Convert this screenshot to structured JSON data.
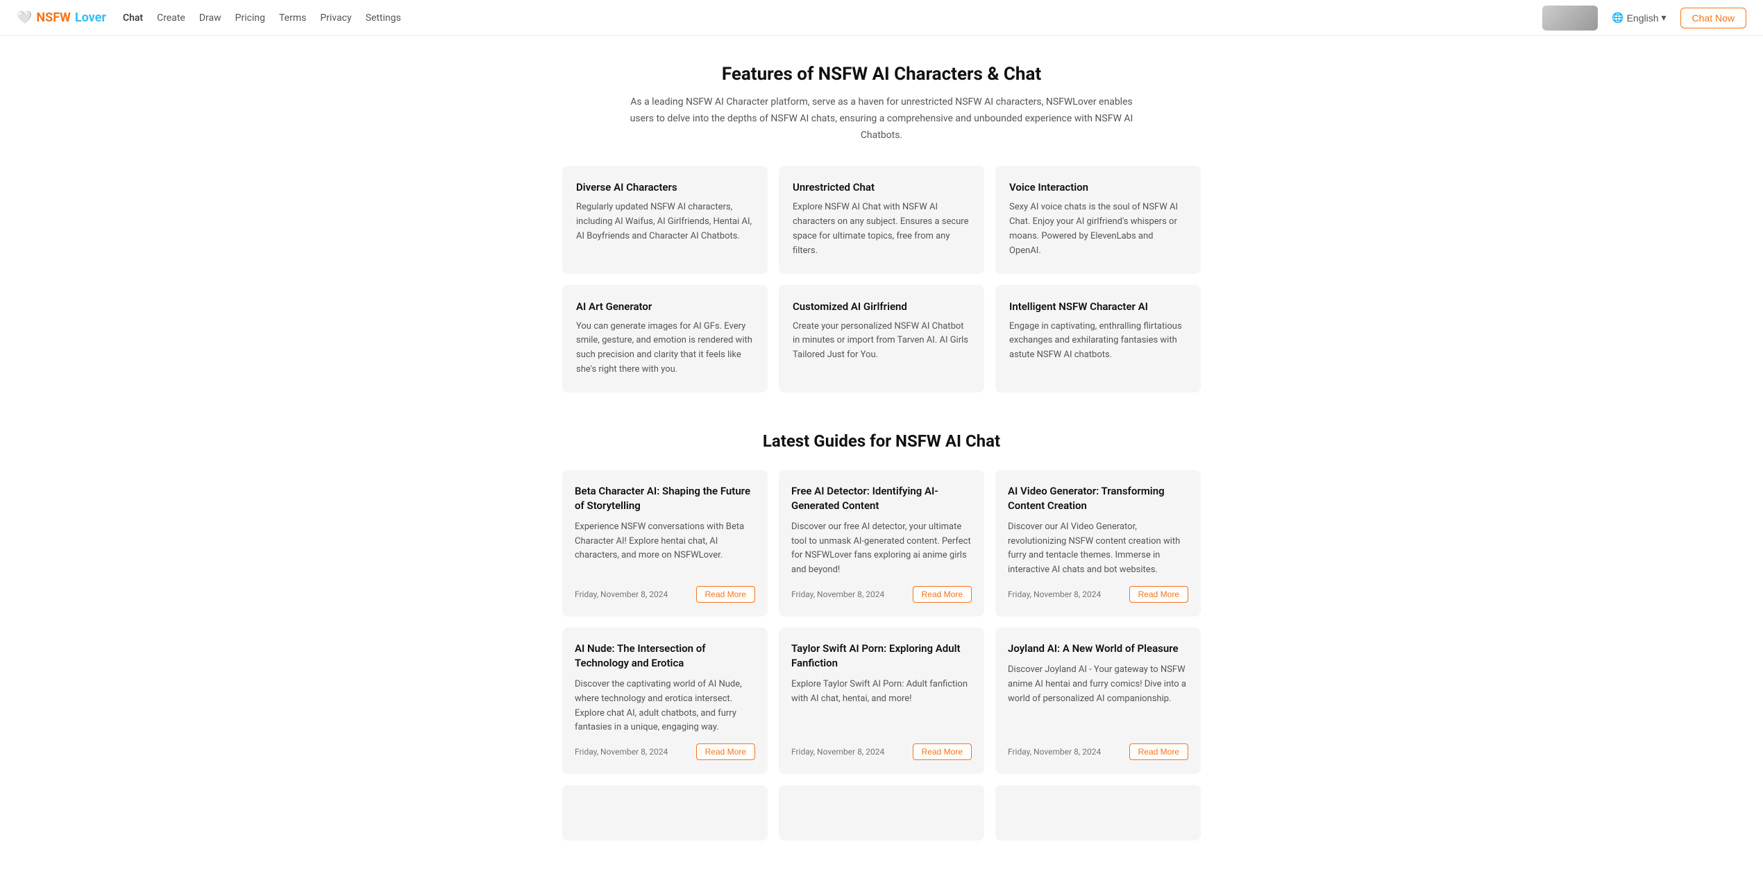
{
  "navbar": {
    "logo_nsfw": "NSFW",
    "logo_lover": "Lover",
    "nav_links": [
      {
        "label": "Chat",
        "href": "#",
        "active": true
      },
      {
        "label": "Create",
        "href": "#",
        "active": false
      },
      {
        "label": "Draw",
        "href": "#",
        "active": false
      },
      {
        "label": "Pricing",
        "href": "#",
        "active": false
      },
      {
        "label": "Terms",
        "href": "#",
        "active": false
      },
      {
        "label": "Privacy",
        "href": "#",
        "active": false
      },
      {
        "label": "Settings",
        "href": "#",
        "active": false
      }
    ],
    "language_label": "English",
    "chat_now_label": "Chat Now"
  },
  "features_section": {
    "title": "Features of NSFW AI Characters & Chat",
    "description": "As a leading NSFW AI Character platform, serve as a haven for unrestricted NSFW AI characters, NSFWLover enables users to delve into the depths of NSFW AI chats, ensuring a comprehensive and unbounded experience with NSFW AI Chatbots.",
    "cards": [
      {
        "title": "Diverse AI Characters",
        "description": "Regularly updated NSFW AI characters, including AI Waifus, AI Girlfriends, Hentai AI, AI Boyfriends and Character AI Chatbots."
      },
      {
        "title": "Unrestricted Chat",
        "description": "Explore NSFW AI Chat with NSFW AI characters on any subject. Ensures a secure space for ultimate topics, free from any filters."
      },
      {
        "title": "Voice Interaction",
        "description": "Sexy AI voice chats is the soul of NSFW AI Chat. Enjoy your AI girlfriend's whispers or moans. Powered by ElevenLabs and OpenAI."
      },
      {
        "title": "AI Art Generator",
        "description": "You can generate images for AI GFs. Every smile, gesture, and emotion is rendered with such precision and clarity that it feels like she's right there with you."
      },
      {
        "title": "Customized AI Girlfriend",
        "description": "Create your personalized NSFW AI Chatbot in minutes or import from Tarven AI. AI Girls Tailored Just for You."
      },
      {
        "title": "Intelligent NSFW Character AI",
        "description": "Engage in captivating, enthralling flirtatious exchanges and exhilarating fantasies with astute NSFW AI chatbots."
      }
    ]
  },
  "guides_section": {
    "title": "Latest Guides for NSFW AI Chat",
    "cards": [
      {
        "title": "Beta Character AI: Shaping the Future of Storytelling",
        "description": "Experience NSFW conversations with Beta Character AI! Explore hentai chat, AI characters, and more on NSFWLover.",
        "date": "Friday, November 8, 2024",
        "read_more": "Read More"
      },
      {
        "title": "Free AI Detector: Identifying AI-Generated Content",
        "description": "Discover our free AI detector, your ultimate tool to unmask AI-generated content. Perfect for NSFWLover fans exploring ai anime girls and beyond!",
        "date": "Friday, November 8, 2024",
        "read_more": "Read More"
      },
      {
        "title": "AI Video Generator: Transforming Content Creation",
        "description": "Discover our AI Video Generator, revolutionizing NSFW content creation with furry and tentacle themes. Immerse in interactive AI chats and bot websites.",
        "date": "Friday, November 8, 2024",
        "read_more": "Read More"
      },
      {
        "title": "AI Nude: The Intersection of Technology and Erotica",
        "description": "Discover the captivating world of AI Nude, where technology and erotica intersect. Explore chat AI, adult chatbots, and furry fantasies in a unique, engaging way.",
        "date": "Friday, November 8, 2024",
        "read_more": "Read More"
      },
      {
        "title": "Taylor Swift AI Porn: Exploring Adult Fanfiction",
        "description": "Explore Taylor Swift AI Porn: Adult fanfiction with AI chat, hentai, and more!",
        "date": "Friday, November 8, 2024",
        "read_more": "Read More"
      },
      {
        "title": "Joyland AI: A New World of Pleasure",
        "description": "Discover Joyland AI - Your gateway to NSFW anime AI hentai and furry comics! Dive into a world of personalized AI companionship.",
        "date": "Friday, November 8, 2024",
        "read_more": "Read More"
      }
    ],
    "bottom_cards": [
      {
        "title": ""
      },
      {
        "title": ""
      },
      {
        "title": ""
      }
    ]
  }
}
